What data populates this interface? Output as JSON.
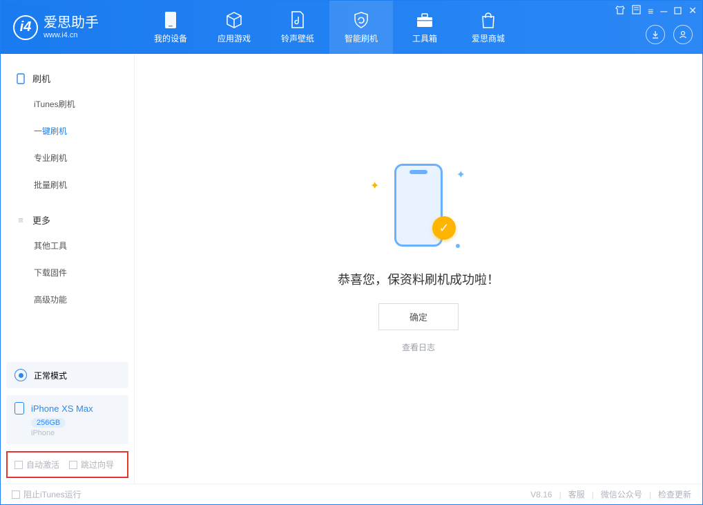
{
  "app": {
    "name": "爱思助手",
    "site": "www.i4.cn"
  },
  "nav": {
    "items": [
      {
        "label": "我的设备"
      },
      {
        "label": "应用游戏"
      },
      {
        "label": "铃声壁纸"
      },
      {
        "label": "智能刷机"
      },
      {
        "label": "工具箱"
      },
      {
        "label": "爱思商城"
      }
    ]
  },
  "sidebar": {
    "section1_title": "刷机",
    "section1_items": [
      {
        "label": "iTunes刷机"
      },
      {
        "label": "一键刷机"
      },
      {
        "label": "专业刷机"
      },
      {
        "label": "批量刷机"
      }
    ],
    "section2_title": "更多",
    "section2_items": [
      {
        "label": "其他工具"
      },
      {
        "label": "下载固件"
      },
      {
        "label": "高级功能"
      }
    ],
    "mode": "正常模式",
    "device_name": "iPhone XS Max",
    "device_storage": "256GB",
    "device_type": "iPhone",
    "check_auto_activate": "自动激活",
    "check_skip_guide": "跳过向导"
  },
  "main": {
    "success_message": "恭喜您，保资料刷机成功啦！",
    "ok_button": "确定",
    "view_log": "查看日志"
  },
  "footer": {
    "block_itunes": "阻止iTunes运行",
    "version": "V8.16",
    "support": "客服",
    "wechat": "微信公众号",
    "check_update": "检查更新"
  }
}
